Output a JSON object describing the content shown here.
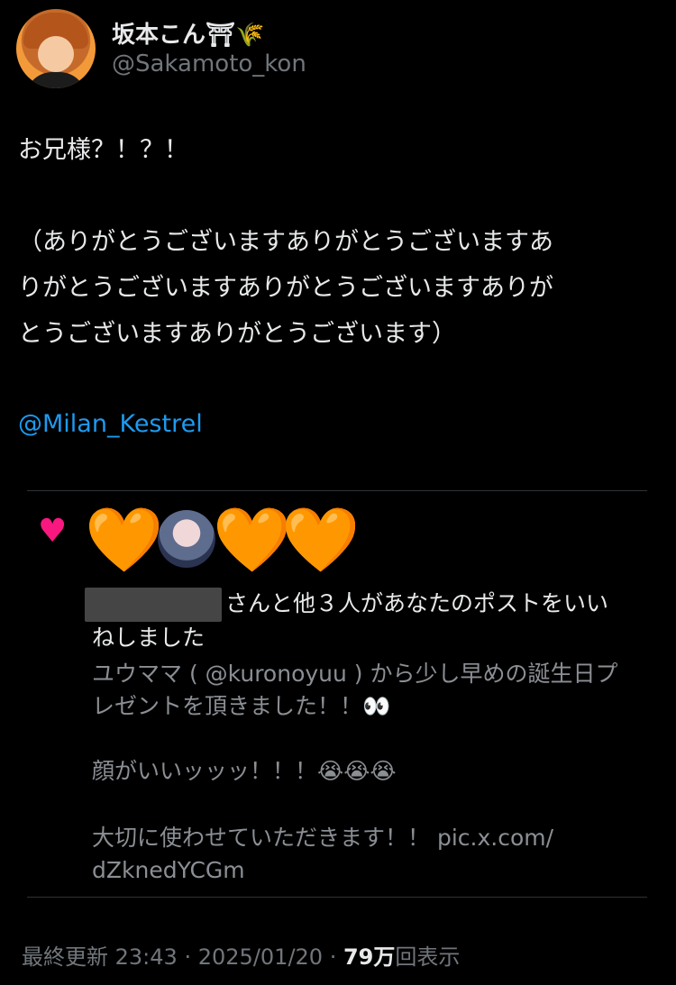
{
  "author": {
    "name": "坂本こん⛩🌾",
    "handle": "@Sakamoto_kon"
  },
  "post": {
    "line1": "お兄様？！？！",
    "line2": "（ありがとうございますありがとうございますあ",
    "line3": "りがとうございますありがとうございますありが",
    "line4": "とうございますありがとうございます）",
    "mention": "@Milan_Kestrel"
  },
  "notification": {
    "text_line1": "さんと他３人があなたのポストをいい",
    "text_line2": "ねしました",
    "quote_line1": "ユウママ ( @kuronoyuu ) から少し早めの誕生日プ",
    "quote_line2": "レゼントを頂きました！！👀",
    "quote_line3": "顔がいいッッッ！！！😭😭😭",
    "quote_line4": "大切に使わせていただきます！！ pic.x.com/",
    "quote_line5": "dZknedYCGm",
    "heart_orange": "🧡"
  },
  "footer": {
    "label": "最終更新",
    "time": "23:43",
    "date": "2025/01/20",
    "views_count": "79万",
    "views_label": "回表示"
  },
  "colors": {
    "background": "#000000",
    "text": "#e7e9ea",
    "secondary": "#71767b",
    "link": "#1d9bf0",
    "like": "#f91880"
  }
}
